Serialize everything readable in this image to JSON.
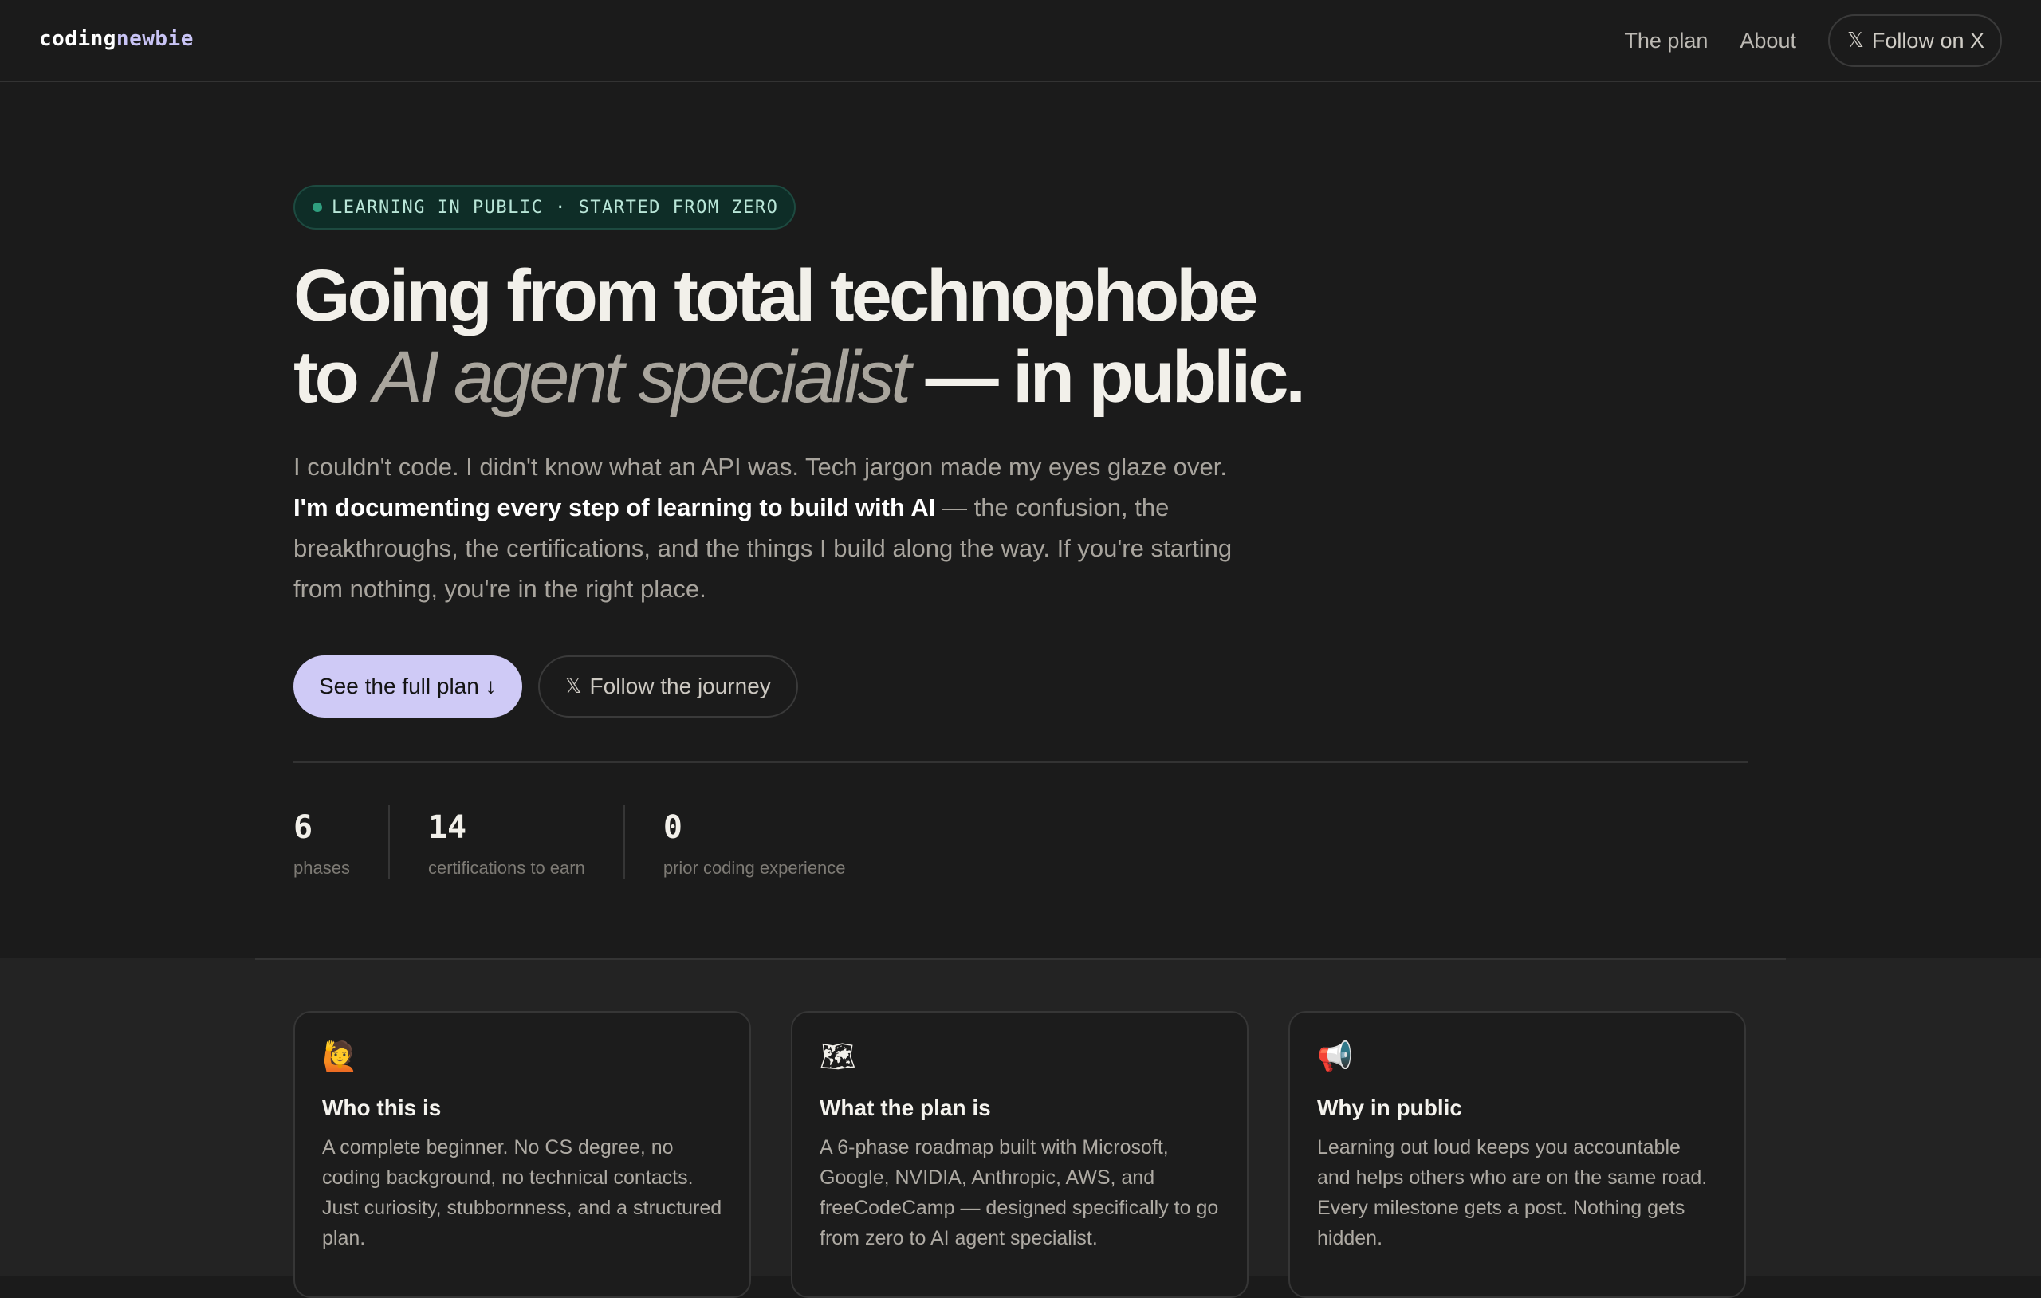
{
  "nav": {
    "logo_part1": "coding",
    "logo_part2": "newbie",
    "links": [
      "The plan",
      "About"
    ],
    "follow_label": "Follow on X"
  },
  "hero": {
    "pill": "LEARNING IN PUBLIC · STARTED FROM ZERO",
    "headline_line1": "Going from total technophobe",
    "headline_to": "to ",
    "headline_em": "AI agent specialist",
    "headline_end": " — in public.",
    "lede_1": "I couldn't code. I didn't know what an API was. Tech jargon made my eyes glaze over. ",
    "lede_strong": "I'm documenting every step of learning to build with AI",
    "lede_2": " — the confusion, the breakthroughs, the certifications, and the things I build along the way. If you're starting from nothing, you're in the right place.",
    "cta_primary": "See the full plan ↓",
    "cta_secondary": "Follow the journey"
  },
  "stats": [
    {
      "value": "6",
      "label": "phases"
    },
    {
      "value": "14",
      "label": "certifications to earn"
    },
    {
      "value": "0",
      "label": "prior coding experience"
    }
  ],
  "cards": [
    {
      "icon": "🙋",
      "icon_name": "raising-hand-icon",
      "title": "Who this is",
      "body": "A complete beginner. No CS degree, no coding background, no technical contacts. Just curiosity, stubbornness, and a structured plan."
    },
    {
      "icon": "🗺",
      "icon_name": "map-icon",
      "title": "What the plan is",
      "body": "A 6-phase roadmap built with Microsoft, Google, NVIDIA, Anthropic, AWS, and freeCodeCamp — designed specifically to go from zero to AI agent specialist."
    },
    {
      "icon": "📢",
      "icon_name": "megaphone-icon",
      "title": "Why in public",
      "body": "Learning out loud keeps you accountable and helps others who are on the same road. Every milestone gets a post. Nothing gets hidden."
    }
  ],
  "icons": {
    "x_logo": "𝕏"
  },
  "colors": {
    "background": "#1b1b1b",
    "accent": "#cfcaf6",
    "pill_bg": "#0e2d27",
    "pill_dot": "#2f9f7f"
  }
}
